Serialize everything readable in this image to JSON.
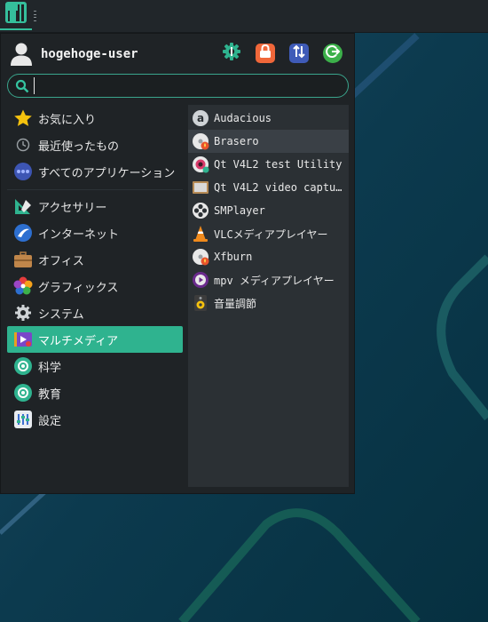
{
  "panel": {
    "launcher_icon": "manjaro-logo-icon"
  },
  "user": {
    "name": "hogehoge-user",
    "avatar_icon": "user-avatar-icon"
  },
  "actions": [
    {
      "name": "settings-action",
      "icon": "gear-icon",
      "color": "#2fb38f"
    },
    {
      "name": "lock-action",
      "icon": "lock-icon",
      "color": "#f0673a"
    },
    {
      "name": "switch-user-action",
      "icon": "switch-user-icon",
      "color": "#3f5bb8"
    },
    {
      "name": "logout-action",
      "icon": "logout-icon",
      "color": "#3cb04a"
    }
  ],
  "search": {
    "value": "",
    "placeholder": "",
    "icon": "search-icon"
  },
  "categories_top": [
    {
      "label": "お気に入り",
      "icon": "star-icon"
    },
    {
      "label": "最近使ったもの",
      "icon": "clock-icon"
    },
    {
      "label": "すべてのアプリケーション",
      "icon": "apps-icon"
    }
  ],
  "categories": [
    {
      "label": "アクセサリー",
      "icon": "accessories-icon"
    },
    {
      "label": "インターネット",
      "icon": "internet-icon"
    },
    {
      "label": "オフィス",
      "icon": "office-icon"
    },
    {
      "label": "グラフィックス",
      "icon": "graphics-icon"
    },
    {
      "label": "システム",
      "icon": "system-icon"
    },
    {
      "label": "マルチメディア",
      "icon": "multimedia-icon",
      "active": true
    },
    {
      "label": "科学",
      "icon": "science-icon"
    },
    {
      "label": "教育",
      "icon": "education-icon"
    },
    {
      "label": "設定",
      "icon": "settings-icon"
    }
  ],
  "apps": [
    {
      "label": "Audacious",
      "icon": "audacious-icon"
    },
    {
      "label": "Brasero",
      "icon": "brasero-icon",
      "hover": true
    },
    {
      "label": "Qt V4L2 test Utility",
      "icon": "qv4l2-icon"
    },
    {
      "label": "Qt V4L2 video captu…",
      "icon": "qvidcap-icon"
    },
    {
      "label": "SMPlayer",
      "icon": "smplayer-icon"
    },
    {
      "label": "VLCメディアプレイヤー",
      "icon": "vlc-icon"
    },
    {
      "label": "Xfburn",
      "icon": "xfburn-icon"
    },
    {
      "label": "mpv メディアプレイヤー",
      "icon": "mpv-icon"
    },
    {
      "label": "音量調節",
      "icon": "volume-control-icon"
    }
  ],
  "colors": {
    "accent": "#2fb38f",
    "menu_bg": "#1f2326",
    "app_pane_bg": "#2b3034"
  }
}
